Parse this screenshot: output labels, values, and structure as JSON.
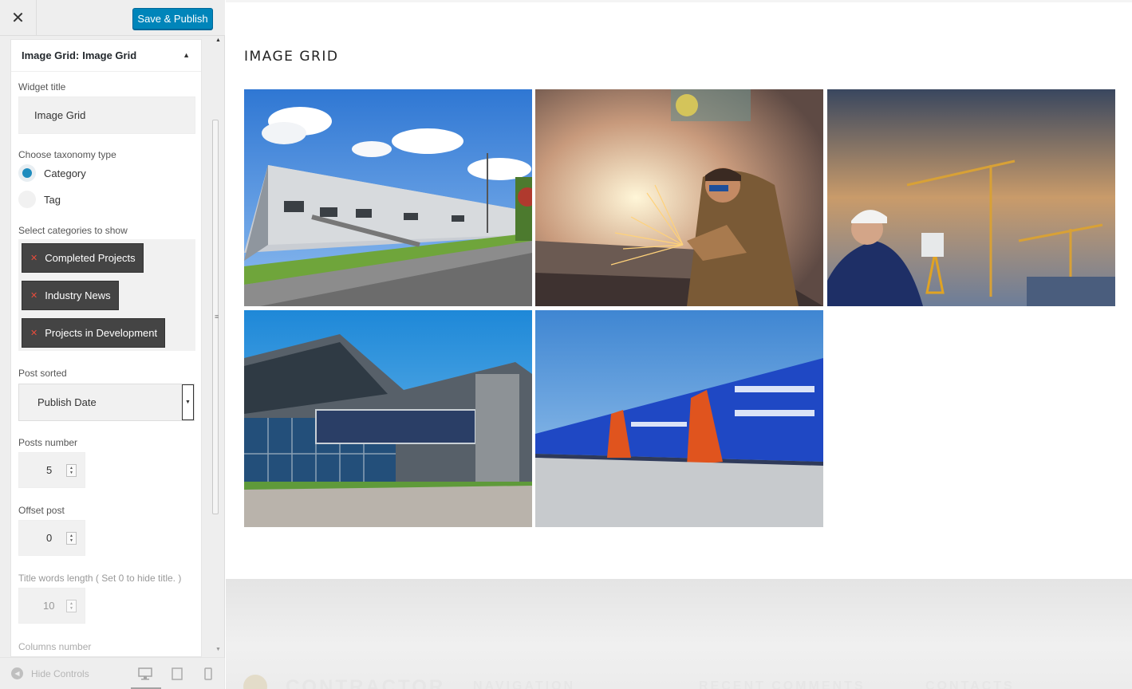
{
  "topbar": {
    "close_icon": "close-icon",
    "publish_label": "Save & Publish",
    "publish_color": "#0085ba"
  },
  "widget": {
    "header_type": "Image Grid:",
    "header_title": "Image Grid",
    "widget_title_label": "Widget title",
    "widget_title_value": "Image Grid",
    "taxonomy_label": "Choose taxonomy type",
    "taxonomy_options": [
      {
        "label": "Category",
        "checked": true
      },
      {
        "label": "Tag",
        "checked": false
      }
    ],
    "categories_label": "Select categories to show",
    "categories": [
      "Completed Projects",
      "Industry News",
      "Projects in Development"
    ],
    "post_sorted_label": "Post sorted",
    "post_sorted_value": "Publish Date",
    "posts_number_label": "Posts number",
    "posts_number_value": "5",
    "offset_label": "Offset post",
    "offset_value": "0",
    "title_words_label": "Title words length ( Set 0 to hide title. )",
    "title_words_value": "10",
    "columns_label": "Columns number"
  },
  "footer_controls": {
    "hide_controls_label": "Hide Controls",
    "devices": [
      "desktop-icon",
      "tablet-icon",
      "mobile-icon"
    ]
  },
  "preview": {
    "grid_title": "IMAGE GRID",
    "images": [
      {
        "name": "warehouse-photo",
        "alt": "industrial warehouse building"
      },
      {
        "name": "welder-photo",
        "alt": "worker grinding metal with sparks"
      },
      {
        "name": "surveyor-photo",
        "alt": "engineer with tower cranes"
      },
      {
        "name": "office-building-photo",
        "alt": "modern glass office building"
      },
      {
        "name": "blue-warehouse-photo",
        "alt": "long blue logistics warehouse"
      }
    ],
    "footer_words": [
      "CONTRACTOR",
      "NAVIGATION",
      "RECENT COMMENTS",
      "CONTACTS"
    ]
  }
}
